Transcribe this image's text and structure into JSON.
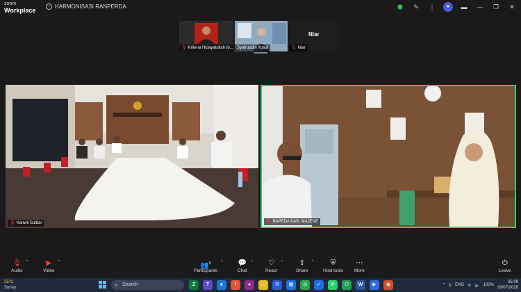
{
  "app": {
    "brand_line1": "zoom",
    "brand_line2": "Workplace",
    "meeting_title": "HARMONISASI RANPERDA"
  },
  "thumbnails": [
    {
      "name": "Kriiena Hidayatullah Ib...",
      "muted": true
    },
    {
      "name": "Syafruddin Yusuf",
      "muted": false
    },
    {
      "name": "Niar",
      "muted": true,
      "display_name": "Niar"
    }
  ],
  "tiles": [
    {
      "label": "Kanwil Sulbar",
      "muted": true
    },
    {
      "label": "BAPEDA KAB. MAJENE",
      "muted": true,
      "active": true
    }
  ],
  "toolbar": {
    "audio": "Audio",
    "video": "Video",
    "participants": "Participants",
    "participants_count": "5",
    "chat": "Chat",
    "react": "React",
    "share": "Share",
    "host_tools": "Host tools",
    "more": "More",
    "leave": "Leave"
  },
  "taskbar": {
    "temp": "25°C",
    "weather": "Sunny",
    "search_placeholder": "Search",
    "lang": "ENG",
    "battery": "100%",
    "time": "05:09",
    "date": "29/07/2026"
  },
  "colors": {
    "active_border": "#2ecc71",
    "leave": "#ff3b30",
    "muted_mic": "#ff3b30"
  }
}
